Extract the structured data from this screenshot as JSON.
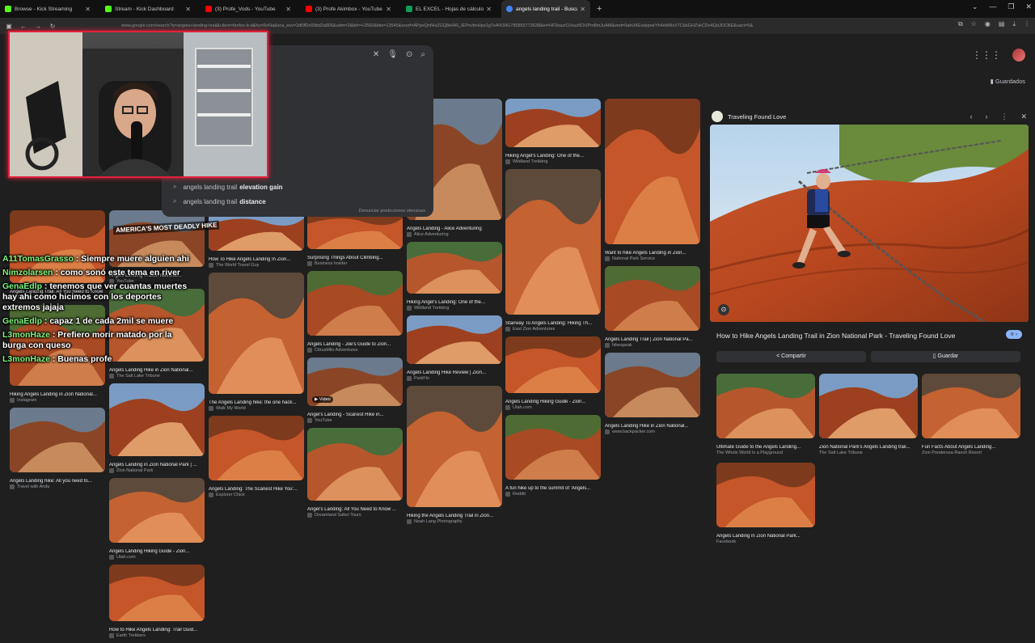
{
  "tabs": [
    {
      "label": "Browse - Kick Streaming",
      "color": "#53fc18"
    },
    {
      "label": "Stream - Kick Dashboard",
      "color": "#53fc18"
    },
    {
      "label": "(3) Profe_Vods - YouTube",
      "color": "#ff0000"
    },
    {
      "label": "(3) Profe Akimbox - YouTube",
      "color": "#ff0000"
    },
    {
      "label": "EL EXCEL - Hojas de cálculo de",
      "color": "#0f9d58"
    },
    {
      "label": "angels landing trail - Buscar co",
      "color": "#4285f4",
      "active": true
    }
  ],
  "address_bar": {
    "url": "www.google.com/search?q=angels+landing+trail&client=firefox-b-d&hs=RsNq&sca_esv=2d0ff2e09bd2a805&udm=2&bih=+2560&biw=13545&sxsrf=APpeQnfHsZGQ8eHKl_IEPevlmHpo1g7eA%3A1785855773638&ei=HF9xazrDJvuz5OUPm8mJuAM&ved=0ahUKEwispoeYh4eWAxX7CbkGHZvkCDo4QdJDCBE&uact=5&"
  },
  "search": {
    "suggestions": [
      {
        "prefix": "angels landing trail",
        "bold": "elevation gain"
      },
      {
        "prefix": "angels landing trail",
        "bold": "distance"
      }
    ],
    "report_text": "Denunciar predicciones ofensivas"
  },
  "header": {
    "saved_label": "Guardados"
  },
  "grid": {
    "col1": [
      {
        "title": "Angels Landing Trail: All You Need to Know",
        "source": "Travel with Ardu"
      },
      {
        "title": "Hiking Angels Landing in Zion National...",
        "source": "Instagram"
      },
      {
        "title": "Angels Landing hike: All you need to...",
        "source": "Travel with Andu"
      }
    ],
    "col2": [
      {
        "title": "Angels Landing in Zion National...",
        "source": "YouTube"
      },
      {
        "title": "Angels Landing Hike in Zion National...",
        "source": "The Salt Lake Tribune"
      },
      {
        "title": "Angels Landing in Zion National Park | ...",
        "source": "Zion National Park"
      },
      {
        "title": "Angels Landing Hiking Guide - Zion...",
        "source": "Utah.com"
      },
      {
        "title": "How to Hike Angels Landing: Trail Guid...",
        "source": "Earth Trekkers"
      }
    ],
    "col3": [
      {
        "title": "How To Hike Angels Landing In Zion...",
        "source": "The World Travel Guy"
      },
      {
        "title": "The Angels Landing hike: the one hack...",
        "source": "Walk My World"
      },
      {
        "title": "Angels Landing: The Scariest Hike You'...",
        "source": "Explorer Chick"
      }
    ],
    "col4": [
      {
        "title": "Surprising Things About Climbing...",
        "source": "Business Insider"
      },
      {
        "title": "Angels Landing - Joe's Guide to Zion...",
        "source": "CitrusMilo Adventures"
      },
      {
        "title": "Angel's Landing - Scariest Hike in...",
        "source": "YouTube",
        "badge": "Video"
      },
      {
        "title": "Angel's Landing: All You Need to Know ...",
        "source": "Dreamland Safari Tours"
      }
    ],
    "col5": [
      {
        "title": "Angels Landing - Alice Adventuring",
        "source": "Alice Adventuring"
      },
      {
        "title": "Hiking Angel's Landing: One of the...",
        "source": "Wildland Trekking"
      },
      {
        "title": "Angels Landing Hike Review | Zion...",
        "source": "ParkFlo"
      },
      {
        "title": "Hiking the Angels Landing Trail in Zion...",
        "source": "Noah Lang Photography"
      }
    ],
    "col6": [
      {
        "title": "Hiking Angel's Landing: One of the...",
        "source": "Wildland Trekking"
      },
      {
        "title": "Stairway To Angels Landing: Hiking Th...",
        "source": "East Zion Adventures"
      },
      {
        "title": "Angels Landing Hiking Guide - Zion...",
        "source": "Utah.com"
      },
      {
        "title": "A fun hike up to the summit of 'Angels...",
        "source": "Reddit"
      }
    ],
    "col7": [
      {
        "title": "Want to hike Angels Landing in Zion...",
        "source": "National Park Service"
      },
      {
        "title": "Angels Landing Trail | Zion National Pa...",
        "source": "hikespeak"
      },
      {
        "title": "Angels Landing Hike in Zion National...",
        "source": "www.backpacker.com"
      }
    ]
  },
  "preview": {
    "site": "Traveling Found Love",
    "title": "How to Hike Angels Landing Trail in Zion National Park - Traveling Found Love",
    "visit_label": "Ir",
    "share_label": "Compartir",
    "save_label": "Guardar",
    "related": [
      {
        "title": "Ultimate Guide to the Angels Landing...",
        "source": "The Whole World Is a Playground"
      },
      {
        "title": "Zion National Park's Angels Landing trail...",
        "source": "The Salt Lake Tribune"
      },
      {
        "title": "Fun Facts About Angels Landing...",
        "source": "Zion Ponderosa Ranch Resort"
      },
      {
        "title": "Angels Landing in Zion National Park...",
        "source": "Facebook"
      }
    ]
  },
  "overlay_title": "AMERICA'S MOST DEADLY HIKE",
  "chat": [
    {
      "user": "A11TomasGrasso",
      "text": ": Siempre muere alguien ahi"
    },
    {
      "user": "Nimzolarsen",
      "text": ": como sonó este tema en river"
    },
    {
      "user": "GenaEdlp",
      "text": ": tenemos que ver cuantas muertes hay ahi como hicimos con los deportes extremos jajaja"
    },
    {
      "user": "GenaEdlp",
      "text": ": capaz 1 de cada 2mil se muere"
    },
    {
      "user": "L3monHaze",
      "text": ": Prefiero morir matado por la burga con queso"
    },
    {
      "user": "L3monHaze",
      "text": ": Buenas profe"
    }
  ]
}
